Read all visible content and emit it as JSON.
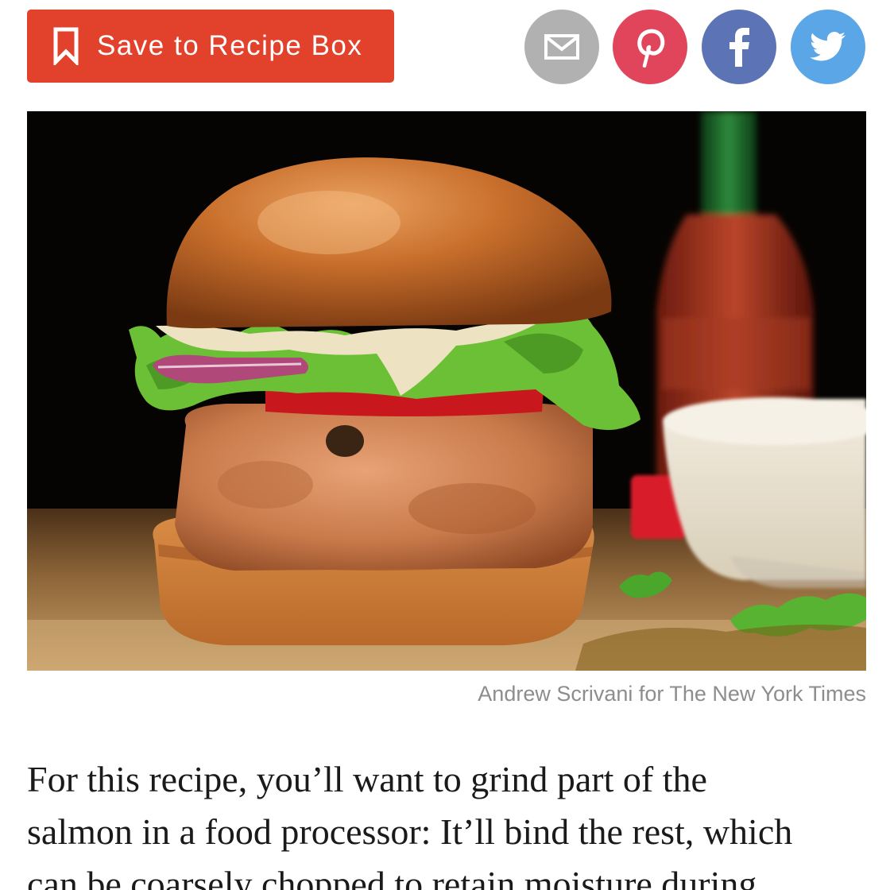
{
  "toolbar": {
    "save_label": "Save to Recipe Box",
    "save_color": "#e2412c",
    "share_buttons": [
      {
        "name": "email",
        "icon": "envelope-icon",
        "color": "#b1b1b1"
      },
      {
        "name": "pinterest",
        "icon": "pinterest-icon",
        "color": "#e0455c"
      },
      {
        "name": "facebook",
        "icon": "facebook-icon",
        "color": "#5c74b5"
      },
      {
        "name": "twitter",
        "icon": "twitter-bird-icon",
        "color": "#5aa6e6"
      }
    ]
  },
  "photo": {
    "credit": "Andrew Scrivani for The New York Times"
  },
  "article": {
    "lines": [
      "For this recipe, you’ll want to grind part of the",
      "salmon in a food processor: It’ll bind the rest, which",
      "can be coarsely chopped to retain moisture during"
    ]
  }
}
